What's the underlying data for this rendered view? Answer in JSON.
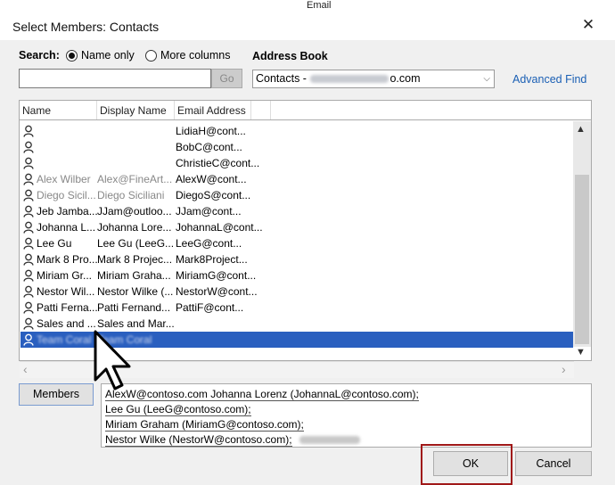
{
  "window": {
    "title": "Select Members: Contacts",
    "close_glyph": "✕",
    "behind_label": "Email"
  },
  "search": {
    "label": "Search:",
    "options": [
      {
        "label": "Name only",
        "selected": true
      },
      {
        "label": "More columns",
        "selected": false
      }
    ],
    "input_value": "",
    "go_label": "Go"
  },
  "address_book": {
    "label": "Address Book",
    "selected_prefix": "Contacts - ",
    "selected_suffix": "o.com"
  },
  "advanced_find_label": "Advanced Find",
  "columns": [
    "Name",
    "Display Name",
    "Email Address"
  ],
  "rows": [
    {
      "name": "",
      "display": "",
      "email": "LidiaH@cont...",
      "gray": false,
      "selected": false
    },
    {
      "name": "",
      "display": "",
      "email": "BobC@cont...",
      "gray": false,
      "selected": false
    },
    {
      "name": "",
      "display": "",
      "email": "ChristieC@cont...",
      "gray": false,
      "selected": false
    },
    {
      "name": "Alex Wilber",
      "display": "Alex@FineArt...",
      "email": "AlexW@cont...",
      "gray": true,
      "selected": false
    },
    {
      "name": "Diego Sicil...",
      "display": "Diego Siciliani",
      "email": "DiegoS@cont...",
      "gray": true,
      "selected": false
    },
    {
      "name": "Jeb Jamba...",
      "display": "JJam@outloo...",
      "email": "JJam@cont...",
      "gray": false,
      "selected": false
    },
    {
      "name": "Johanna L...",
      "display": "Johanna Lore...",
      "email": "JohannaL@cont...",
      "gray": false,
      "selected": false
    },
    {
      "name": "Lee Gu",
      "display": "Lee Gu (LeeG...",
      "email": "LeeG@cont...",
      "gray": false,
      "selected": false
    },
    {
      "name": "Mark 8 Pro...",
      "display": "Mark 8 Projec...",
      "email": "Mark8Project...",
      "gray": false,
      "selected": false
    },
    {
      "name": "Miriam Gr...",
      "display": "Miriam Graha...",
      "email": "MiriamG@cont...",
      "gray": false,
      "selected": false
    },
    {
      "name": "Nestor Wil...",
      "display": "Nestor Wilke (...",
      "email": "NestorW@cont...",
      "gray": false,
      "selected": false
    },
    {
      "name": "Patti Ferna...",
      "display": "Patti Fernand...",
      "email": "PattiF@cont...",
      "gray": false,
      "selected": false
    },
    {
      "name": "Sales and ...",
      "display": "Sales and Mar...",
      "email": "",
      "gray": false,
      "selected": false
    },
    {
      "name": "Team Coral",
      "display": "Team Coral",
      "email": "",
      "gray": false,
      "selected": true
    }
  ],
  "members": {
    "button_label": "Members",
    "lines": [
      "AlexW@contoso.com  Johanna Lorenz (JohannaL@contoso.com);",
      "Lee Gu (LeeG@contoso.com);",
      "Miriam Graham (MiriamG@contoso.com);",
      "Nestor Wilke (NestorW@contoso.com);"
    ]
  },
  "buttons": {
    "ok": "OK",
    "cancel": "Cancel"
  },
  "colors": {
    "selection": "#2a5fbf",
    "link": "#1a5fb4",
    "ok_highlight": "#a01818"
  }
}
